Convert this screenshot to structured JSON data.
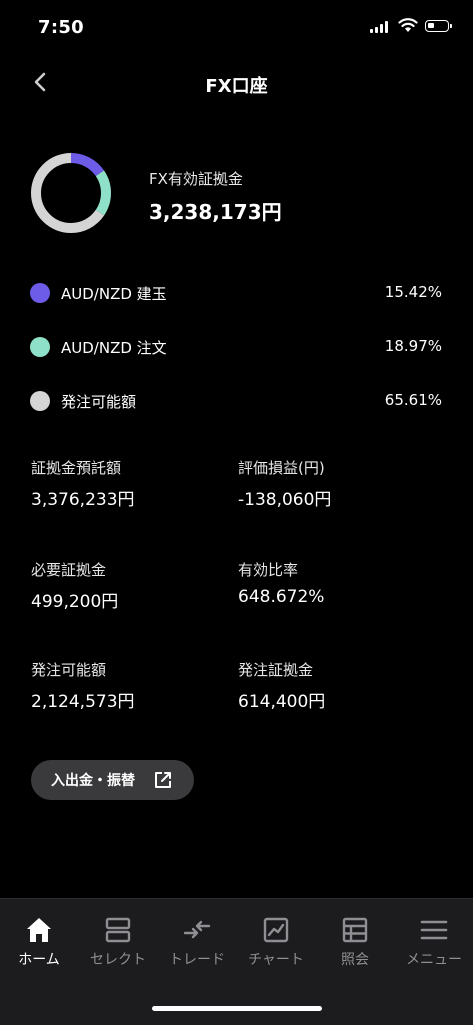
{
  "status_bar": {
    "time": "7:50"
  },
  "nav": {
    "title": "FX口座"
  },
  "summary": {
    "label": "FX有効証拠金",
    "value": "3,238,173円",
    "colors": {
      "open": "#6c5ce7",
      "order": "#8fe0c8",
      "available": "#d4d4d4"
    }
  },
  "legend": [
    {
      "label": "AUD/NZD 建玉",
      "percent": "15.42%",
      "color": "#6c5ce7"
    },
    {
      "label": "AUD/NZD 注文",
      "percent": "18.97%",
      "color": "#8fe0c8"
    },
    {
      "label": "発注可能額",
      "percent": "65.61%",
      "color": "#d4d4d4"
    }
  ],
  "stats": [
    {
      "label": "証拠金預託額",
      "value": "3,376,233円"
    },
    {
      "label": "評価損益(円)",
      "value": "-138,060円"
    },
    {
      "label": "必要証拠金",
      "value": "499,200円"
    },
    {
      "label": "有効比率",
      "value": "648.672%"
    },
    {
      "label": "発注可能額",
      "value": "2,124,573円"
    },
    {
      "label": "発注証拠金",
      "value": "614,400円"
    }
  ],
  "link_button": {
    "label": "入出金・振替",
    "icon": "external-link-icon"
  },
  "tabbar": {
    "tabs": [
      {
        "label": "ホーム",
        "icon": "home-icon",
        "active": true
      },
      {
        "label": "セレクト",
        "icon": "select-icon",
        "active": false
      },
      {
        "label": "トレード",
        "icon": "trade-icon",
        "active": false
      },
      {
        "label": "チャート",
        "icon": "chart-icon",
        "active": false
      },
      {
        "label": "照会",
        "icon": "inquiry-icon",
        "active": false
      },
      {
        "label": "メニュー",
        "icon": "menu-icon",
        "active": false
      }
    ]
  }
}
